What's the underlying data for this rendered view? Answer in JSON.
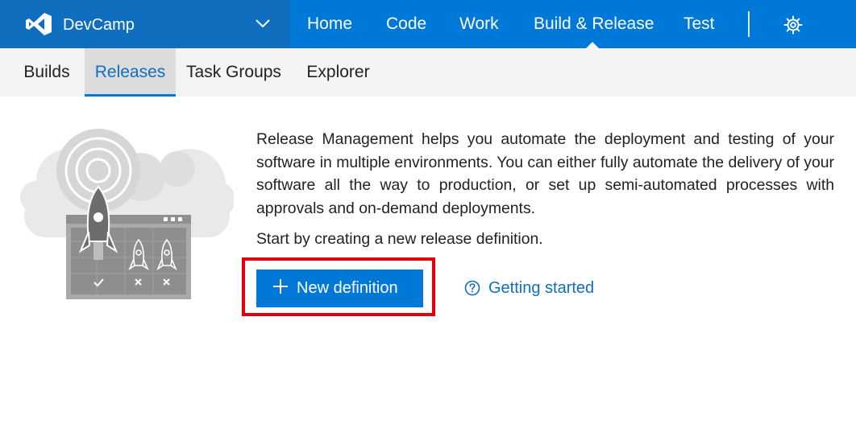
{
  "header": {
    "project_name": "DevCamp",
    "nav": [
      {
        "label": "Home"
      },
      {
        "label": "Code"
      },
      {
        "label": "Work"
      },
      {
        "label": "Build & Release"
      },
      {
        "label": "Test"
      }
    ],
    "active_nav": "Build & Release",
    "icons": {
      "logo": "visual-studio-logo",
      "project_menu": "chevron-down-icon",
      "settings": "gear-icon"
    }
  },
  "subnav": {
    "tabs": [
      {
        "label": "Builds"
      },
      {
        "label": "Releases"
      },
      {
        "label": "Task Groups"
      },
      {
        "label": "Explorer"
      }
    ],
    "active_tab": "Releases"
  },
  "main": {
    "description": "Release Management helps you automate the deployment and testing of your software in multiple environments. You can either fully automate the delivery of your software all the way to production, or set up semi-automated processes with approvals and on-demand deployments.",
    "start_text": "Start by creating a new release definition.",
    "new_definition_label": "New definition",
    "getting_started_label": "Getting started",
    "icons": {
      "new": "plus-icon",
      "help": "question-circle-icon",
      "illustration": "rocket-release-illustration"
    }
  },
  "colors": {
    "brand": "#0078d7",
    "brand_dark": "#106ebe",
    "subnav_bg": "#f4f4f4",
    "active_tab_bg": "#dcdcdc",
    "highlight": "#e3000b",
    "link": "#106ebe"
  }
}
